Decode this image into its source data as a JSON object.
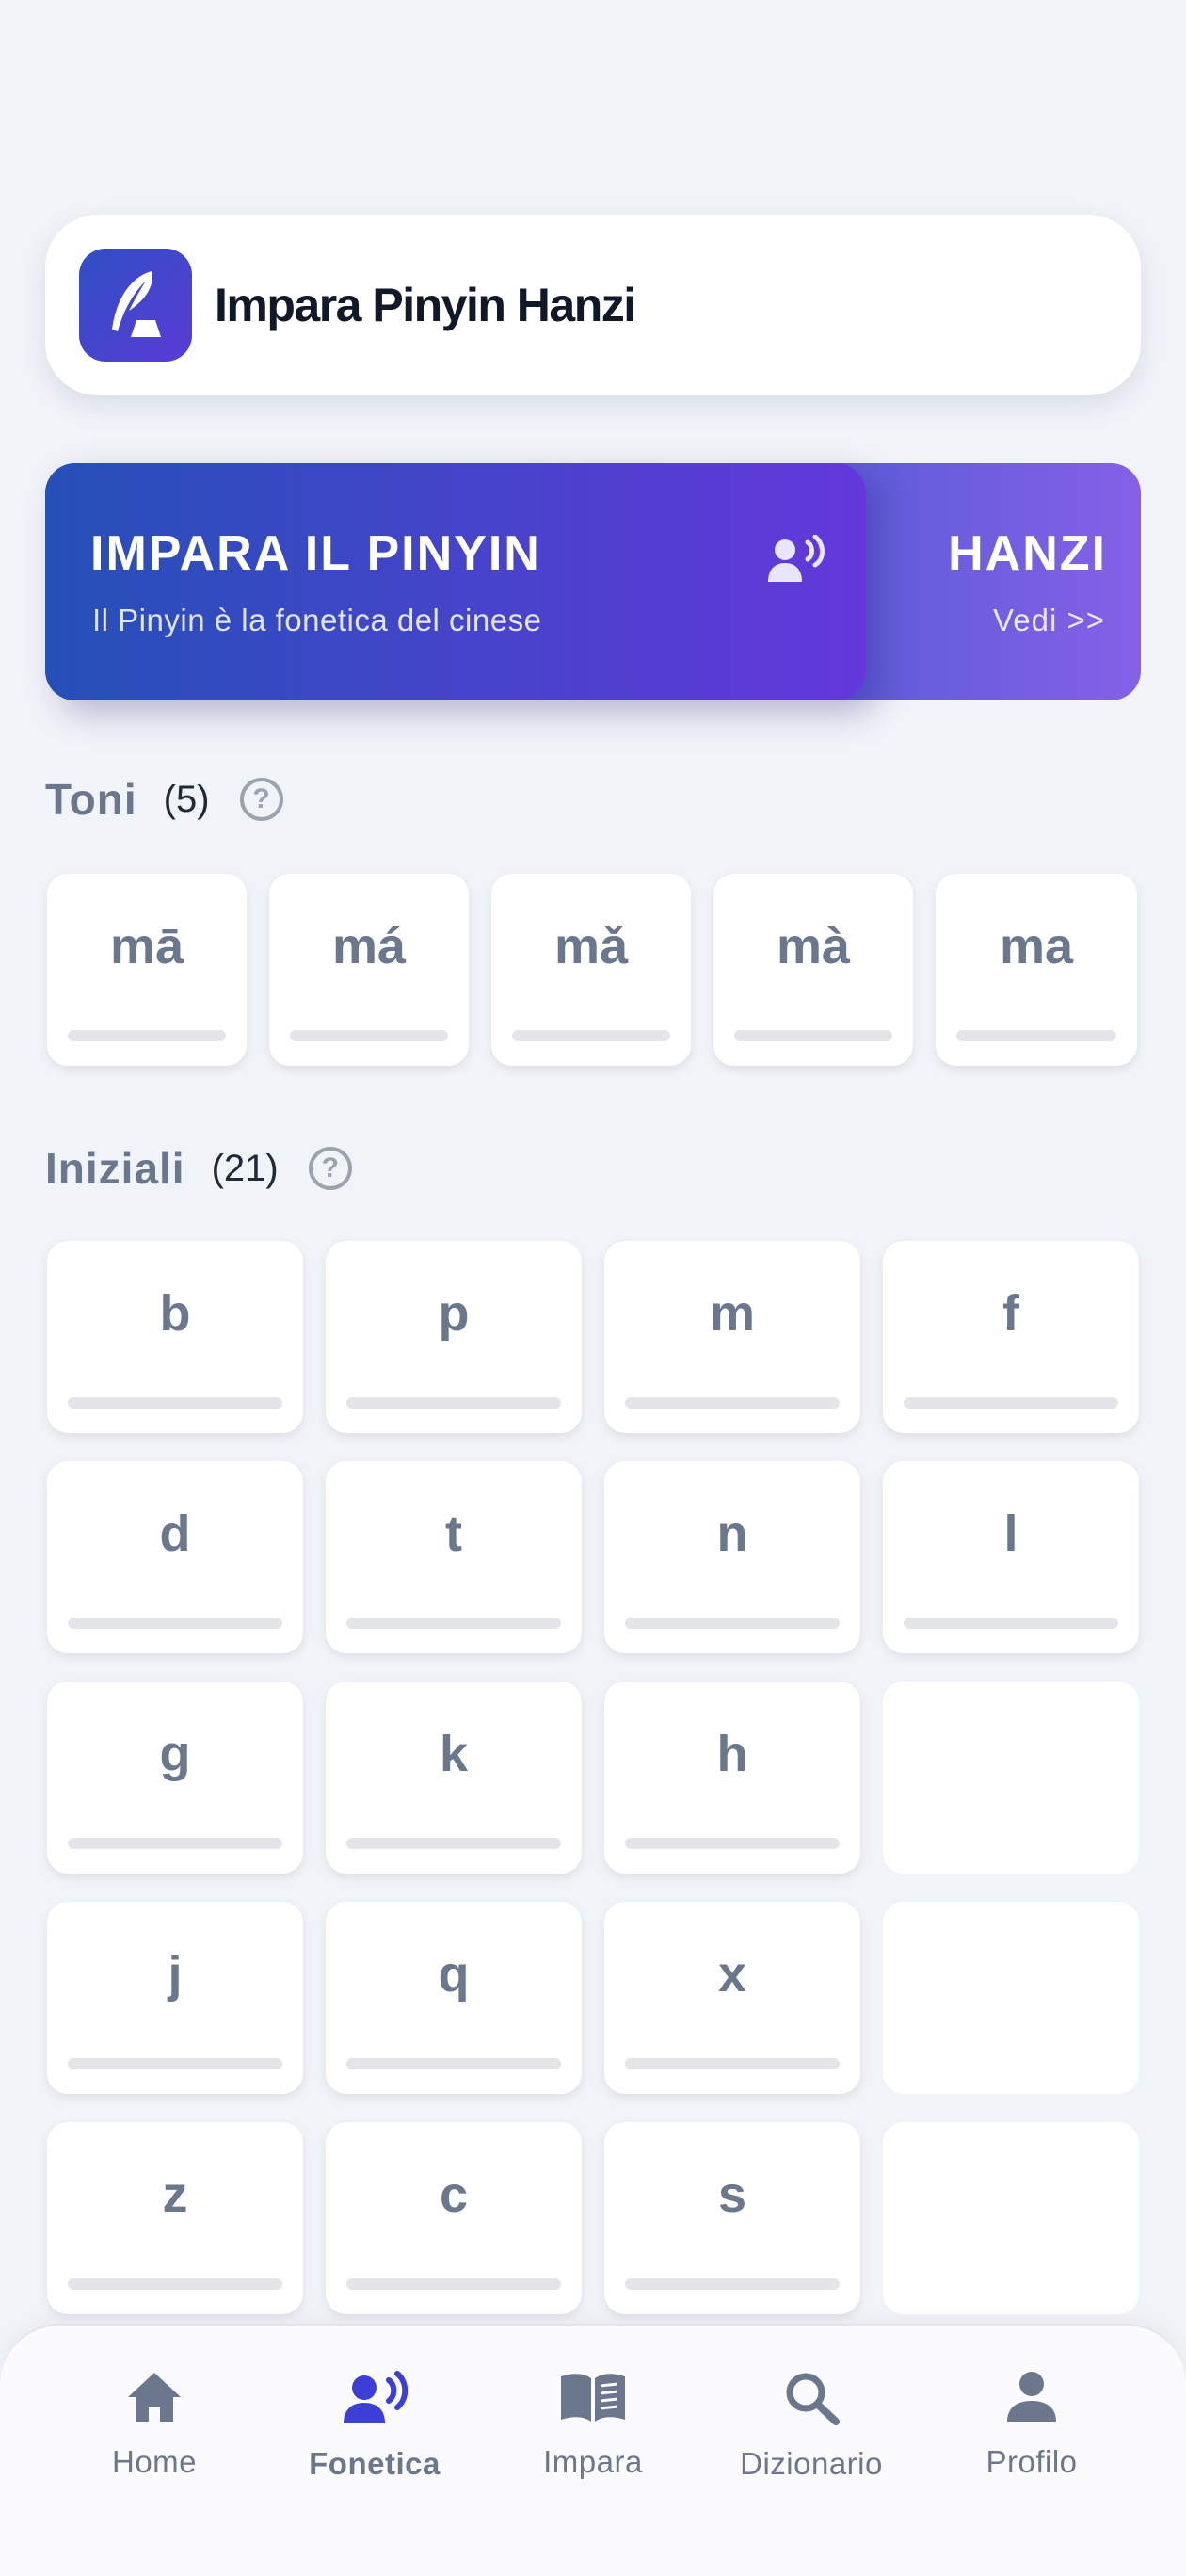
{
  "header": {
    "title": "Impara Pinyin Hanzi",
    "logo_icon": "quill-pen-icon"
  },
  "banner": {
    "title": "IMPARA IL PINYIN",
    "subtitle": "Il Pinyin è la fonetica del cinese",
    "icon": "speaking-person-icon",
    "secondary_title": "HANZI",
    "secondary_link": "Vedi >>"
  },
  "tones": {
    "title": "Toni",
    "count": "(5)",
    "help": "?",
    "items": [
      "mā",
      "má",
      "mǎ",
      "mà",
      "ma"
    ]
  },
  "initials": {
    "title": "Iniziali",
    "count": "(21)",
    "help": "?",
    "items": [
      "b",
      "p",
      "m",
      "f",
      "d",
      "t",
      "n",
      "l",
      "g",
      "k",
      "h",
      "j",
      "q",
      "x",
      "z",
      "c",
      "s"
    ]
  },
  "nav": {
    "items": [
      {
        "label": "Home",
        "icon": "home-icon"
      },
      {
        "label": "Fonetica",
        "icon": "speaking-person-icon",
        "active": true
      },
      {
        "label": "Impara",
        "icon": "book-icon"
      },
      {
        "label": "Dizionario",
        "icon": "search-icon"
      },
      {
        "label": "Profilo",
        "icon": "person-icon"
      }
    ]
  },
  "colors": {
    "accent": "#3b3fd6",
    "banner_start": "#2550b8",
    "banner_end": "#6438db",
    "background": "#f0f3f8"
  }
}
